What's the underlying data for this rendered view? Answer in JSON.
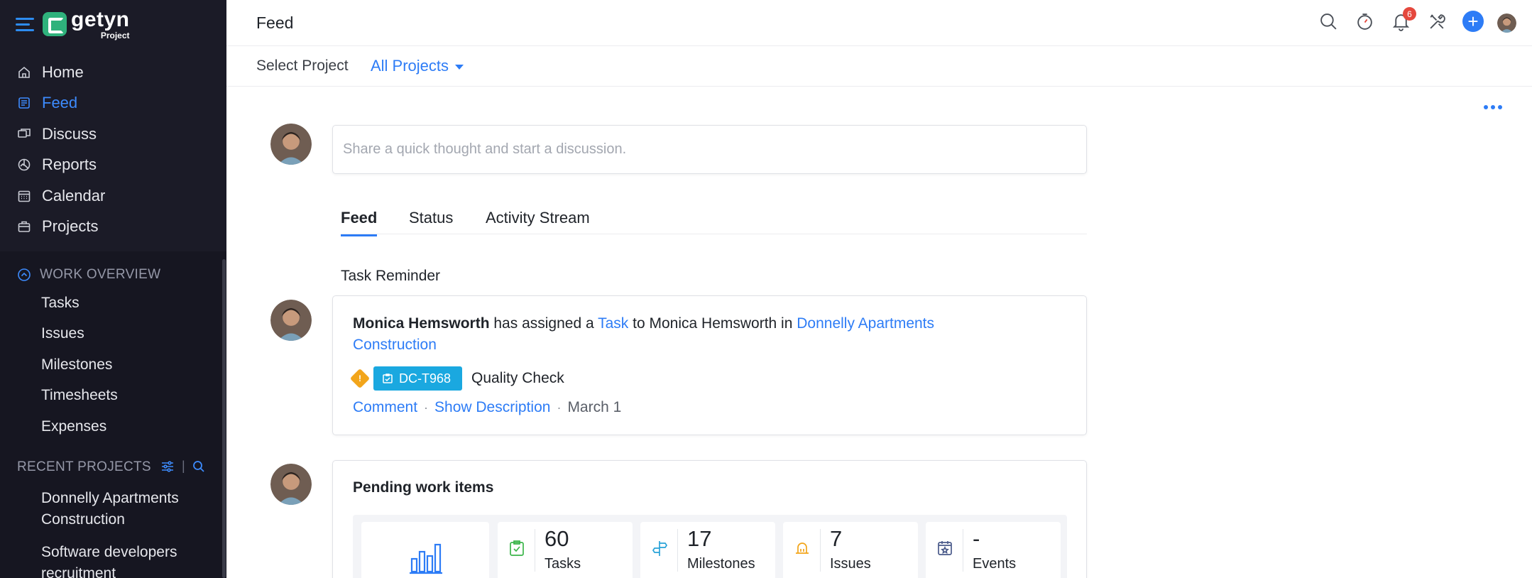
{
  "app": {
    "brand": "getyn",
    "product": "Project"
  },
  "sidebar": {
    "nav": [
      {
        "label": "Home",
        "icon": "home-icon"
      },
      {
        "label": "Feed",
        "icon": "feed-icon",
        "active": true
      },
      {
        "label": "Discuss",
        "icon": "discuss-icon"
      },
      {
        "label": "Reports",
        "icon": "reports-icon"
      },
      {
        "label": "Calendar",
        "icon": "calendar-icon"
      },
      {
        "label": "Projects",
        "icon": "projects-icon"
      }
    ],
    "work_overview": {
      "title": "WORK OVERVIEW",
      "items": [
        "Tasks",
        "Issues",
        "Milestones",
        "Timesheets",
        "Expenses"
      ]
    },
    "recent_projects": {
      "title": "RECENT PROJECTS",
      "items": [
        "Donnelly Apartments Construction",
        "Software developers recruitment"
      ]
    }
  },
  "header": {
    "title": "Feed",
    "notification_count": "6"
  },
  "project_filter": {
    "label": "Select Project",
    "value": "All Projects"
  },
  "composer": {
    "placeholder": "Share a quick thought and start a discussion."
  },
  "tabs": [
    "Feed",
    "Status",
    "Activity Stream"
  ],
  "task_reminder": {
    "section_title": "Task Reminder",
    "actor": "Monica Hemsworth",
    "action_text": "has assigned a",
    "object_link": "Task",
    "to_text": "to Monica Hemsworth in",
    "project_link": "Donnelly Apartments Construction",
    "task_id": "DC-T968",
    "task_name": "Quality Check",
    "comment_link": "Comment",
    "description_link": "Show Description",
    "date": "March 1"
  },
  "pending": {
    "title": "Pending work items",
    "stats": [
      {
        "value": "60",
        "label": "Tasks",
        "icon": "task-check-icon",
        "color": "#3bb54a"
      },
      {
        "value": "17",
        "label": "Milestones",
        "icon": "signpost-icon",
        "color": "#29a3d8"
      },
      {
        "value": "7",
        "label": "Issues",
        "icon": "bell-bug-icon",
        "color": "#f2a51a"
      },
      {
        "value": "-",
        "label": "Events",
        "icon": "calendar-star-icon",
        "color": "#4a5a8a"
      }
    ]
  },
  "colors": {
    "accent": "#2d7cf6",
    "sidebar_bg": "#1b1b27",
    "task_chip": "#1aa8e0",
    "priority": "#f2a51a",
    "badge": "#e5483d"
  }
}
